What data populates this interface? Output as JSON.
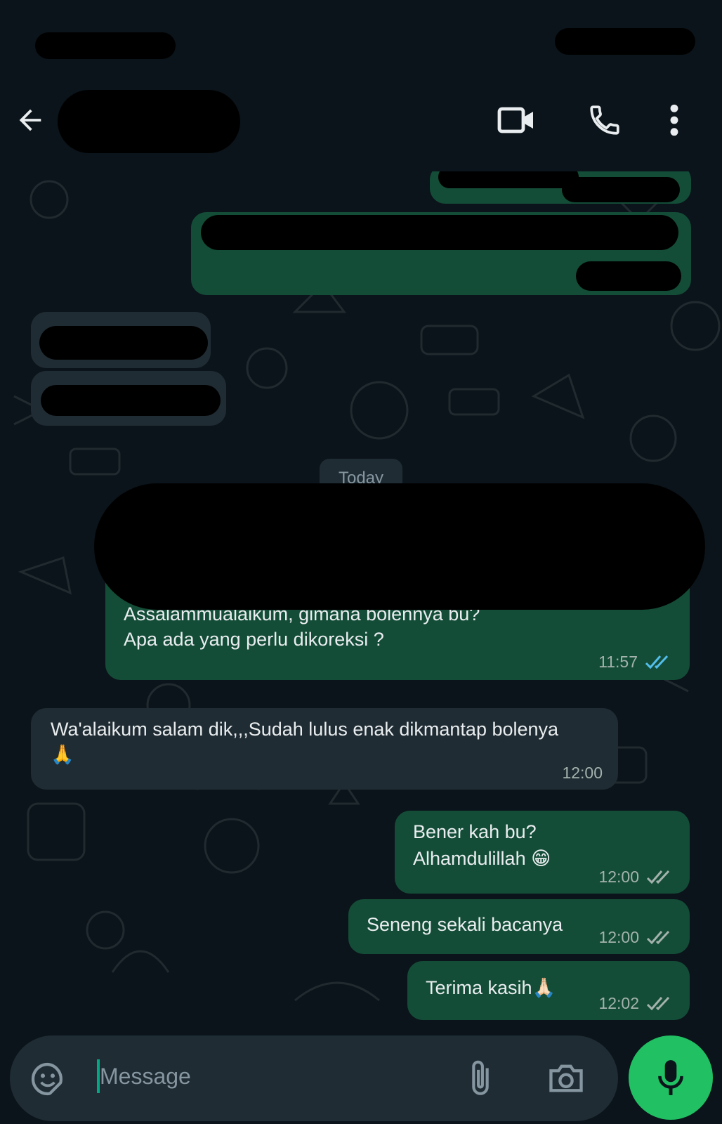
{
  "header": {
    "back_icon": "arrow-left-icon",
    "video_icon": "video-camera-icon",
    "call_icon": "phone-icon",
    "menu_icon": "more-vertical-icon"
  },
  "chat": {
    "date_separator": "Today",
    "messages": [
      {
        "direction": "out",
        "lines": [
          "Assalammualaikum, gimana bolennya bu?",
          "Apa ada yang perlu dikoreksi ?"
        ],
        "time": "11:57",
        "status": "read"
      },
      {
        "direction": "in",
        "lines": [
          "Wa'alaikum salam dik,,,Sudah lulus enak dikmantap bolenya",
          "🙏"
        ],
        "time": "12:00"
      },
      {
        "direction": "out",
        "lines": [
          "Bener kah bu?",
          "Alhamdulillah 😁"
        ],
        "time": "12:00",
        "status": "delivered"
      },
      {
        "direction": "out",
        "lines": [
          "Seneng sekali bacanya"
        ],
        "time": "12:00",
        "status": "delivered"
      },
      {
        "direction": "out",
        "lines": [
          "Terima kasih🙏🏻"
        ],
        "time": "12:02",
        "status": "delivered"
      }
    ]
  },
  "input": {
    "placeholder": "Message",
    "emoji_icon": "sticker-icon",
    "attach_icon": "paperclip-icon",
    "camera_icon": "camera-icon",
    "mic_icon": "microphone-icon"
  },
  "colors": {
    "background": "#0b141a",
    "outgoing_bubble": "#144d37",
    "incoming_bubble": "#202c33",
    "accent": "#21c063",
    "read_ticks": "#53bdeb"
  }
}
